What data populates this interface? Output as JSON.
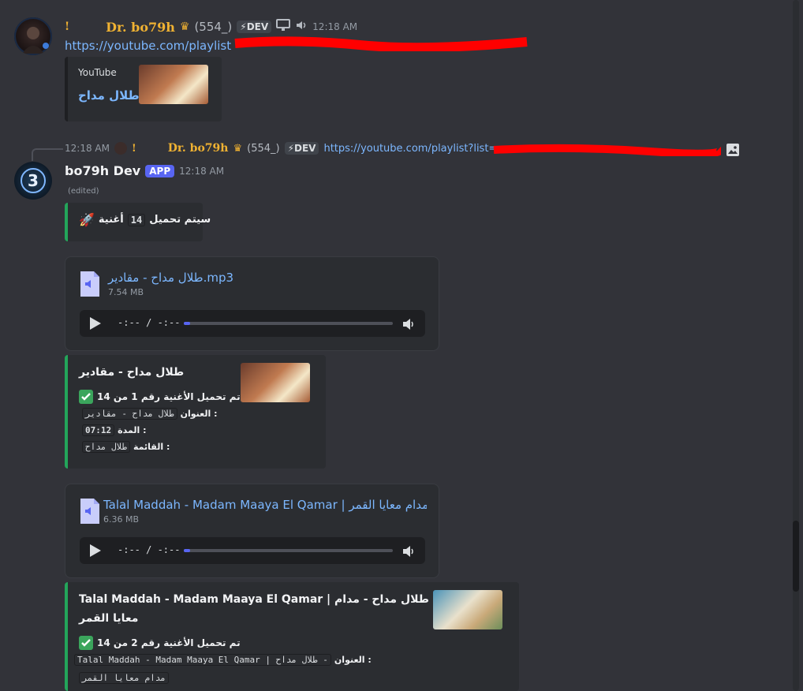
{
  "msg1": {
    "prefix": "!",
    "author": "Dr. bo79h",
    "crown": "♛",
    "tag": "(554_)",
    "dev_badge": "⚡DEV",
    "time": "12:18 AM",
    "link": "https://youtube.com/playlist",
    "embed": {
      "provider": "YouTube",
      "title": "طلال مداح"
    }
  },
  "reply": {
    "time": "12:18 AM",
    "prefix": "!",
    "author": "Dr. bo79h",
    "crown": "♛",
    "tag": "(554_)",
    "dev_badge": "⚡DEV",
    "link": "https://youtube.com/playlist?list="
  },
  "msg2": {
    "author": "bo79h Dev",
    "app_badge": "APP",
    "time": "12:18 AM",
    "edited": "(edited)",
    "info": {
      "prefix": "سيتم تحميل",
      "count": "14",
      "suffix": "أغنية",
      "emoji": "🚀"
    }
  },
  "attachments": [
    {
      "name": "طلال مداح - مقادير.mp3",
      "size": "7.54 MB",
      "time_display": "-:-- / -:--",
      "progress": 0.03
    },
    {
      "name": "Talal Maddah - Madam Maaya El Qamar | مدام معايا القمر - .",
      "size": "6.36 MB",
      "time_display": "-:-- / -:--",
      "progress": 0.03
    }
  ],
  "embeds": [
    {
      "title": "طلال مداح - مقادير",
      "status": "تم تحميل الأغنية رقم 1 من 14",
      "title_label": "العنوان :",
      "title_value": "طلال مداح - مقادير",
      "duration_label": "المدة :",
      "duration_value": "07:12",
      "list_label": "القائمة :",
      "list_value": "طلال مداح"
    },
    {
      "title_line1": "Talal Maddah - Madam Maaya El Qamar | طلال مداح - مدام",
      "title_line2": "معايا القمر",
      "status": "تم تحميل الأغنية رقم 2 من 14",
      "title_label": "العنوان :",
      "title_value_line1": "Talal Maddah - Madam Maaya El Qamar | طلال مداح -",
      "title_value_line2": "مدام معايا القمر"
    }
  ],
  "colors": {
    "background": "#323339",
    "link": "#7cb7ff",
    "accent": "#23a55a",
    "app_badge": "#5865f2",
    "redaction": "#ff0000"
  }
}
